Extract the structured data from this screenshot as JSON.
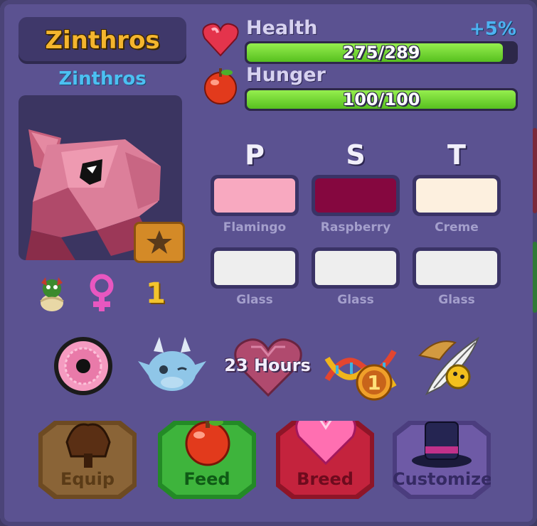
{
  "creature": {
    "name": "Zinthros",
    "species_name": "Zinthros",
    "generation": "1"
  },
  "stats": {
    "health": {
      "label": "Health",
      "value_text": "275/289",
      "fraction": 0.9516,
      "bonus": "+5%"
    },
    "hunger": {
      "label": "Hunger",
      "value_text": "100/100",
      "fraction": 1.0
    }
  },
  "colors": {
    "headers": [
      "P",
      "S",
      "T"
    ],
    "top_row": [
      {
        "name": "Flamingo",
        "hex": "#f8a9c0"
      },
      {
        "name": "Raspberry",
        "hex": "#85073f"
      },
      {
        "name": "Creme",
        "hex": "#fdf0df"
      }
    ],
    "bottom_row": [
      {
        "name": "Glass",
        "hex": "#eeeeee"
      },
      {
        "name": "Glass",
        "hex": "#eeeeee"
      },
      {
        "name": "Glass",
        "hex": "#eeeeee"
      }
    ]
  },
  "traits": {
    "eye_icon": "pink-eye-icon",
    "pet_icon": "blue-dragon-pet-icon",
    "breed_timer": "23 Hours",
    "dna_level": "1",
    "quill_icon": "quill-hat-icon"
  },
  "buttons": {
    "equip": {
      "label": "Equip",
      "color": "#8a6437"
    },
    "feed": {
      "label": "Feed",
      "color": "#3eb43c"
    },
    "breed": {
      "label": "Breed",
      "color": "#c4233d"
    },
    "customize": {
      "label": "Customize",
      "color": "#6e5aa6"
    }
  }
}
